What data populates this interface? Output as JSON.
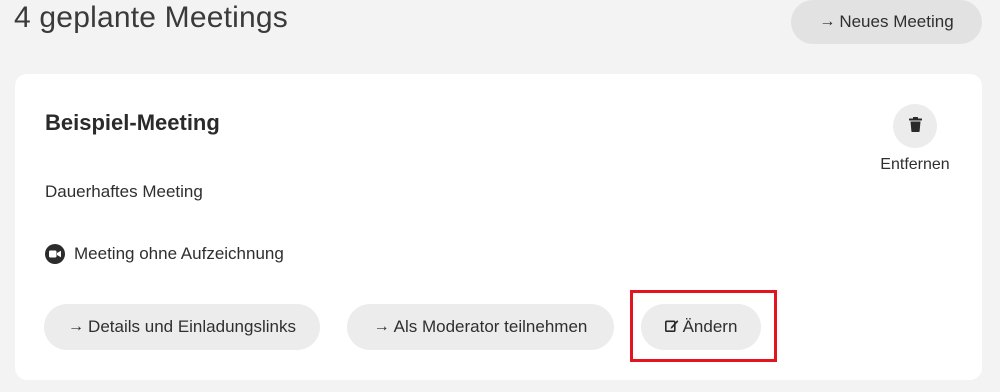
{
  "header": {
    "title": "4 geplante Meetings",
    "new_meeting_label": "Neues Meeting",
    "new_meeting_arrow": "→"
  },
  "meeting": {
    "title": "Beispiel-Meeting",
    "type": "Dauerhaftes Meeting",
    "recording": "Meeting ohne Aufzeichnung",
    "recording_icon": "video-camera-icon",
    "remove_label": "Entfernen",
    "remove_icon": "trash-icon"
  },
  "actions": {
    "details_label": "Details und Einladungslinks",
    "moderator_label": "Als Moderator teilnehmen",
    "edit_label": "Ändern",
    "arrow": "→",
    "edit_icon": "edit-icon"
  },
  "colors": {
    "page_background": "#f3f3f3",
    "card_background": "#ffffff",
    "pill_background": "#ececec",
    "highlight": "#e3141f"
  }
}
